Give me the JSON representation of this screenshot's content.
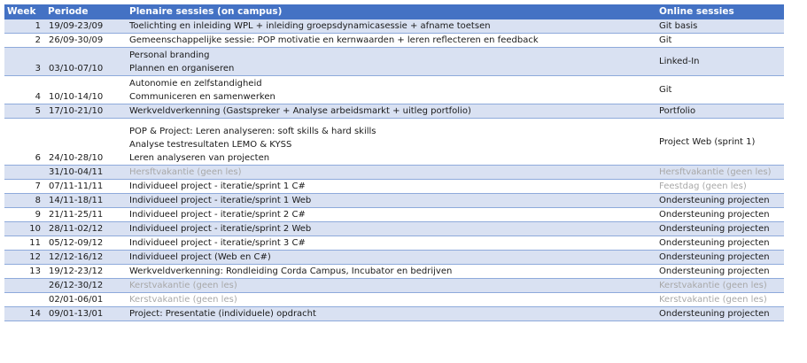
{
  "headers": {
    "week": "Week",
    "periode": "Periode",
    "plenaire": "Plenaire sessies (on campus)",
    "online": "Online sessies"
  },
  "rows": [
    {
      "week": "1",
      "periode": "19/09-23/09",
      "plenaire": [
        "Toelichting en inleiding WPL + inleiding groepsdynamicasessie + afname toetsen"
      ],
      "online": "Git basis",
      "muted": false,
      "online_muted": false
    },
    {
      "week": "2",
      "periode": "26/09-30/09",
      "plenaire": [
        "Gemeenschappelijke sessie: POP motivatie en kernwaarden + leren reflecteren en feedback"
      ],
      "online": "Git",
      "muted": false,
      "online_muted": false
    },
    {
      "week": "3",
      "periode": "03/10-07/10",
      "plenaire": [
        "Personal branding",
        "Plannen en organiseren"
      ],
      "online": "Linked-In",
      "muted": false,
      "online_muted": false
    },
    {
      "week": "4",
      "periode": "10/10-14/10",
      "plenaire": [
        "Autonomie en zelfstandigheid",
        "Communiceren en samenwerken"
      ],
      "online": "Git",
      "muted": false,
      "online_muted": false
    },
    {
      "week": "5",
      "periode": "17/10-21/10",
      "plenaire": [
        "Werkveldverkenning (Gastspreker + Analyse arbeidsmarkt + uitleg portfolio)"
      ],
      "online": "Portfolio",
      "muted": false,
      "online_muted": false
    },
    {
      "week": "6",
      "periode": "24/10-28/10",
      "plenaire": [
        "POP & Project: Leren analyseren: soft skills & hard skills",
        "Analyse testresultaten LEMO & KYSS",
        "Leren analyseren van projecten"
      ],
      "online": "Project Web (sprint 1)",
      "muted": false,
      "online_muted": false
    },
    {
      "week": "",
      "periode": "31/10-04/11",
      "plenaire": [
        "Hersftvakantie (geen les)"
      ],
      "online": "Hersftvakantie (geen les)",
      "muted": true,
      "online_muted": true
    },
    {
      "week": "7",
      "periode": "07/11-11/11",
      "plenaire": [
        "Individueel project - iteratie/sprint 1 C#"
      ],
      "online": "Feestdag (geen les)",
      "muted": false,
      "online_muted": true
    },
    {
      "week": "8",
      "periode": "14/11-18/11",
      "plenaire": [
        "Individueel project - iteratie/sprint 1 Web"
      ],
      "online": "Ondersteuning projecten",
      "muted": false,
      "online_muted": false
    },
    {
      "week": "9",
      "periode": "21/11-25/11",
      "plenaire": [
        "Individueel project - iteratie/sprint 2 C#"
      ],
      "online": "Ondersteuning projecten",
      "muted": false,
      "online_muted": false
    },
    {
      "week": "10",
      "periode": "28/11-02/12",
      "plenaire": [
        "Individueel project - iteratie/sprint 2 Web"
      ],
      "online": "Ondersteuning projecten",
      "muted": false,
      "online_muted": false
    },
    {
      "week": "11",
      "periode": "05/12-09/12",
      "plenaire": [
        "Individueel project - iteratie/sprint 3 C#"
      ],
      "online": "Ondersteuning projecten",
      "muted": false,
      "online_muted": false
    },
    {
      "week": "12",
      "periode": "12/12-16/12",
      "plenaire": [
        "Individueel project (Web en C#)"
      ],
      "online": "Ondersteuning projecten",
      "muted": false,
      "online_muted": false
    },
    {
      "week": "13",
      "periode": "19/12-23/12",
      "plenaire": [
        "Werkveldverkenning: Rondleiding Corda Campus, Incubator en bedrijven"
      ],
      "online": "Ondersteuning projecten",
      "muted": false,
      "online_muted": false
    },
    {
      "week": "",
      "periode": "26/12-30/12",
      "plenaire": [
        "Kerstvakantie (geen les)"
      ],
      "online": "Kerstvakantie (geen les)",
      "muted": true,
      "online_muted": true
    },
    {
      "week": "",
      "periode": "02/01-06/01",
      "plenaire": [
        "Kerstvakantie (geen les)"
      ],
      "online": "Kerstvakantie (geen les)",
      "muted": true,
      "online_muted": true
    },
    {
      "week": "14",
      "periode": "09/01-13/01",
      "plenaire": [
        "Project: Presentatie (individuele) opdracht"
      ],
      "online": "Ondersteuning projecten",
      "muted": false,
      "online_muted": false
    }
  ],
  "colors": {
    "header_bg": "#4472c4",
    "band_bg": "#d9e1f2",
    "border": "#8eaadb",
    "muted_text": "#a8a8a8"
  }
}
